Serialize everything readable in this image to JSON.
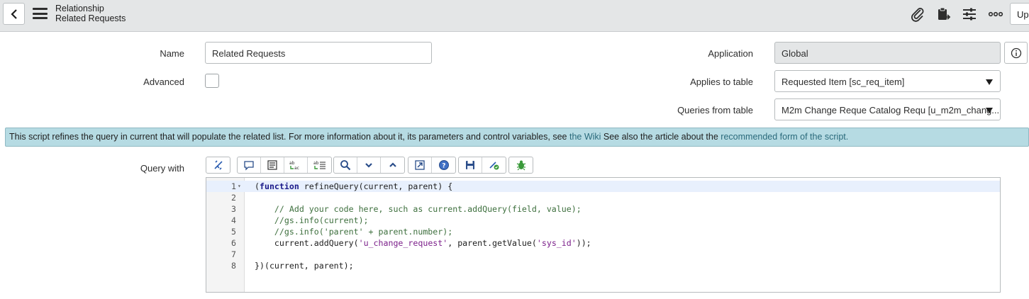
{
  "header": {
    "title": "Relationship",
    "subtitle": "Related Requests",
    "update_label": "Up",
    "icons": [
      "back-icon",
      "hamburger-icon",
      "paperclip-icon",
      "clipboard-icon",
      "sliders-icon",
      "more-icon"
    ]
  },
  "form": {
    "name_label": "Name",
    "name_value": "Related Requests",
    "advanced_label": "Advanced",
    "application_label": "Application",
    "application_value": "Global",
    "applies_label": "Applies to table",
    "applies_value": "Requested Item [sc_req_item]",
    "queries_label": "Queries from table",
    "queries_value": "M2m Change Reque Catalog Requ [u_m2m_chang...",
    "query_with_label": "Query with"
  },
  "infobar": {
    "text1": "This script refines the query in current that will populate the related list. For more information about it, its parameters and control variables, see ",
    "link1": "the Wiki",
    "text2": " See also the article about the ",
    "link2": "recommended form of the script."
  },
  "toolbar": {
    "icons": [
      "format-icon",
      "comment-icon",
      "list-icon",
      "replace-icon",
      "replace-all-icon",
      "search-icon",
      "down-icon",
      "up-icon",
      "fullscreen-icon",
      "help-icon",
      "save-icon",
      "script-debug-icon",
      "debugger-icon"
    ]
  },
  "editor": {
    "lines": [
      {
        "n": "1",
        "t": "(function refineQuery(current, parent) {"
      },
      {
        "n": "2",
        "t": ""
      },
      {
        "n": "3",
        "t": "    // Add your code here, such as current.addQuery(field, value);"
      },
      {
        "n": "4",
        "t": "    //gs.info(current);"
      },
      {
        "n": "5",
        "t": "    //gs.info('parent' + parent.number);"
      },
      {
        "n": "6",
        "t": "    current.addQuery('u_change_request', parent.getValue('sys_id'));"
      },
      {
        "n": "7",
        "t": ""
      },
      {
        "n": "8",
        "t": "})(current, parent);"
      }
    ]
  }
}
